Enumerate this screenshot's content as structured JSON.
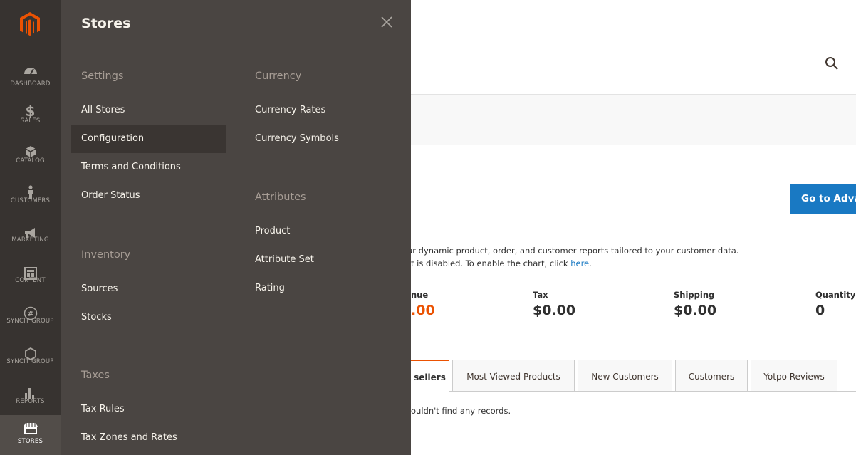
{
  "sidebar": {
    "items": [
      {
        "label": "DASHBOARD",
        "icon": "dashboard-icon"
      },
      {
        "label": "SALES",
        "icon": "dollar-icon"
      },
      {
        "label": "CATALOG",
        "icon": "cube-icon"
      },
      {
        "label": "CUSTOMERS",
        "icon": "person-icon"
      },
      {
        "label": "MARKETING",
        "icon": "megaphone-icon"
      },
      {
        "label": "CONTENT",
        "icon": "layout-icon"
      },
      {
        "label": "SYNCIT GROUP",
        "icon": "syncit-icon"
      },
      {
        "label": "SYNCIT GROUP",
        "icon": "hexagon-icon"
      },
      {
        "label": "REPORTS",
        "icon": "bar-chart-icon"
      },
      {
        "label": "STORES",
        "icon": "store-icon"
      }
    ]
  },
  "flyout": {
    "title": "Stores",
    "settings": {
      "heading": "Settings",
      "items": [
        "All Stores",
        "Configuration",
        "Terms and Conditions",
        "Order Status"
      ]
    },
    "inventory": {
      "heading": "Inventory",
      "items": [
        "Sources",
        "Stocks"
      ]
    },
    "taxes": {
      "heading": "Taxes",
      "items": [
        "Tax Rules",
        "Tax Zones and Rates"
      ]
    },
    "currency": {
      "heading": "Currency",
      "items": [
        "Currency Rates",
        "Currency Symbols"
      ]
    },
    "attributes": {
      "heading": "Attributes",
      "items": [
        "Product",
        "Attribute Set",
        "Rating"
      ]
    }
  },
  "dashboard": {
    "promo_text": "ur dynamic product, order, and customer reports tailored to your customer data.",
    "go_button": "Go to Adva",
    "chart_note": "t is disabled. To enable the chart, click ",
    "chart_link": "here",
    "chart_note_end": ".",
    "totals": [
      {
        "label": "nue",
        "value": ".00"
      },
      {
        "label": "Tax",
        "value": "$0.00"
      },
      {
        "label": "Shipping",
        "value": "$0.00"
      },
      {
        "label": "Quantity",
        "value": "0"
      }
    ],
    "tabs": [
      "sellers",
      "Most Viewed Products",
      "New Customers",
      "Customers",
      "Yotpo Reviews"
    ],
    "no_records": "ouldn't find any records."
  },
  "colors": {
    "sidebar_bg": "#373330",
    "flyout_bg": "#4a4542",
    "accent_orange": "#eb5202",
    "link_blue": "#1979c3"
  }
}
